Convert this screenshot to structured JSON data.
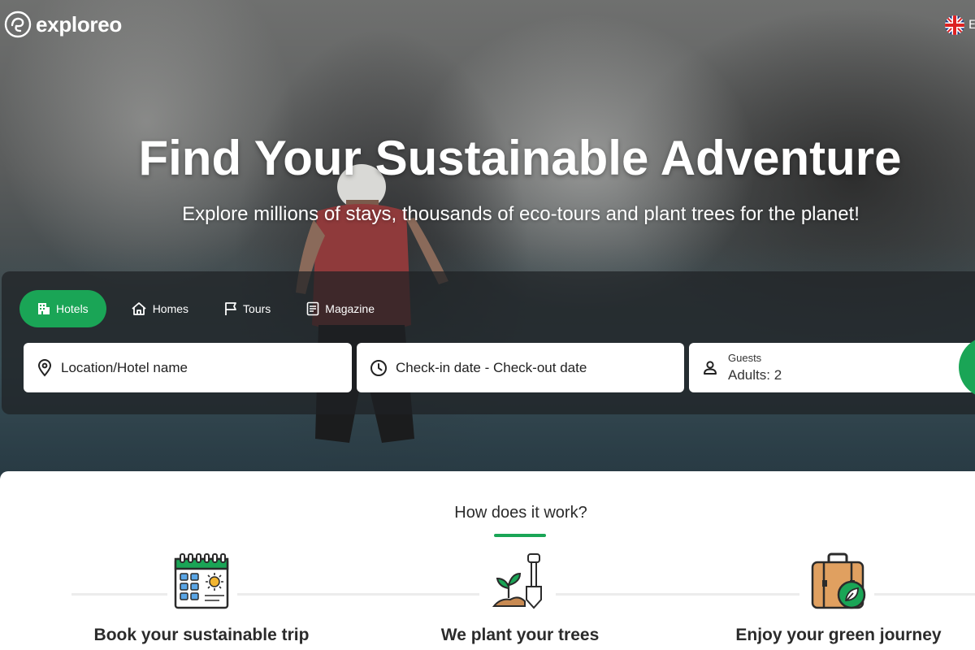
{
  "brand": {
    "name": "exploreo"
  },
  "language": {
    "label": "E"
  },
  "hero": {
    "title": "Find Your Sustainable Adventure",
    "subtitle": "Explore millions of stays, thousands of eco-tours and plant trees for the planet!"
  },
  "search": {
    "tabs": [
      {
        "label": "Hotels",
        "icon": "building-icon",
        "active": true
      },
      {
        "label": "Homes",
        "icon": "house-icon",
        "active": false
      },
      {
        "label": "Tours",
        "icon": "flag-icon",
        "active": false
      },
      {
        "label": "Magazine",
        "icon": "article-icon",
        "active": false
      }
    ],
    "location_placeholder": "Location/Hotel name",
    "dates_placeholder": "Check-in date - Check-out date",
    "guests_label": "Guests",
    "guests_value": "Adults: 2"
  },
  "how_it_works": {
    "title": "How does it work?",
    "steps": [
      {
        "label": "Book your sustainable trip",
        "icon": "calendar-icon"
      },
      {
        "label": "We plant your trees",
        "icon": "plant-shovel-icon"
      },
      {
        "label": "Enjoy your green journey",
        "icon": "eco-suitcase-icon"
      }
    ]
  },
  "colors": {
    "accent": "#1aa556",
    "panel": "#1e2124"
  }
}
